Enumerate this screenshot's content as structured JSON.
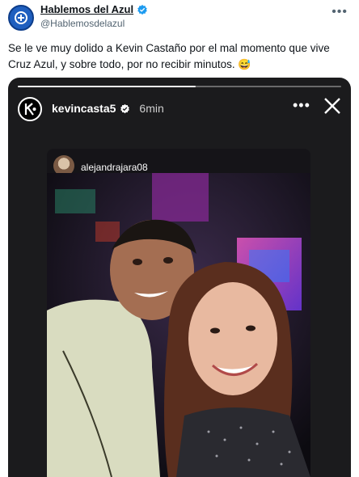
{
  "tweet": {
    "display_name": "Hablemos del Azul",
    "handle": "@Hablemosdelazul",
    "text": "Se le ve muy dolido a Kevin Castaño por el mal momento que vive Cruz Azul, y sobre todo, por no recibir minutos.",
    "emoji": "😅",
    "avatar_icon": "blue-circle-logo",
    "more_icon": "more-icon"
  },
  "story": {
    "username": "kevincasta5",
    "time": "6min",
    "progress": 0.55,
    "avatar_letter": "K",
    "more_label": "•••",
    "close_icon": "close-icon",
    "verified_icon": "verified-icon"
  },
  "shared_post": {
    "username": "alejandrajara08"
  },
  "colors": {
    "brand_blue": "#1f5fbf",
    "verified_blue": "#1d9bf0",
    "story_bg": "#1b1b1d"
  }
}
